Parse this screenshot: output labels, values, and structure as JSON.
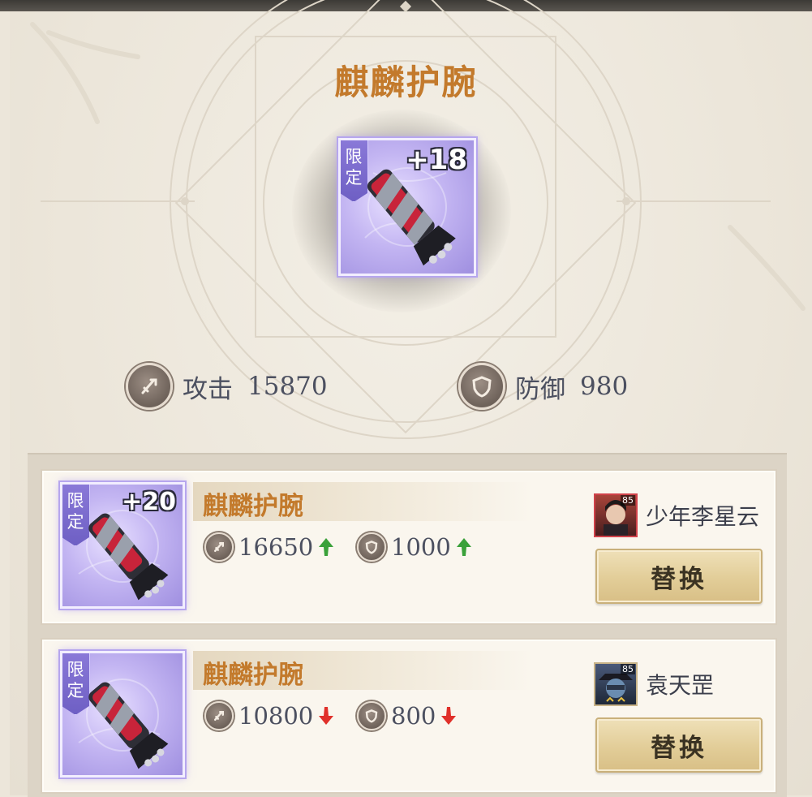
{
  "equipment": {
    "name": "麒麟护腕",
    "limited_tag": "限定",
    "enhance": "+18",
    "attack_label": "攻击",
    "attack_value": "15870",
    "defense_label": "防御",
    "defense_value": "980"
  },
  "candidates": [
    {
      "name": "麒麟护腕",
      "limited_tag": "限定",
      "enhance": "+20",
      "attack": "16650",
      "attack_trend": "up",
      "defense": "1000",
      "defense_trend": "up",
      "owner_name": "少年李星云",
      "owner_level": "85",
      "button": "替换"
    },
    {
      "name": "麒麟护腕",
      "limited_tag": "限定",
      "enhance": "",
      "attack": "10800",
      "attack_trend": "down",
      "defense": "800",
      "defense_trend": "down",
      "owner_name": "袁天罡",
      "owner_level": "85",
      "button": "替换"
    }
  ],
  "colors": {
    "title": "#c37a2c",
    "up_arrow": "#3aa13a",
    "down_arrow": "#e0302a",
    "card_purple": "#b6a6ee"
  },
  "icons": {
    "attack": "sword-icon",
    "defense": "shield-icon",
    "trend_up": "arrow-up-icon",
    "trend_down": "arrow-down-icon"
  }
}
